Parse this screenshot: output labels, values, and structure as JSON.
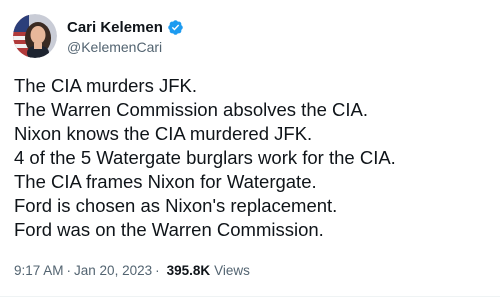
{
  "author": {
    "name": "Cari Kelemen",
    "handle": "@KelemenCari",
    "verified_color": "#1d9bf0"
  },
  "tweet": {
    "lines": [
      "The CIA murders JFK.",
      "The Warren Commission absolves the CIA.",
      "Nixon knows the CIA murdered JFK.",
      "4 of the 5 Watergate burglars work for the CIA.",
      "The CIA frames Nixon for Watergate.",
      "Ford is chosen as Nixon's replacement.",
      "Ford was on the Warren Commission."
    ]
  },
  "meta": {
    "time": "9:17 AM",
    "separator": "·",
    "date": "Jan 20, 2023",
    "views_count": "395.8K",
    "views_label": "Views"
  }
}
